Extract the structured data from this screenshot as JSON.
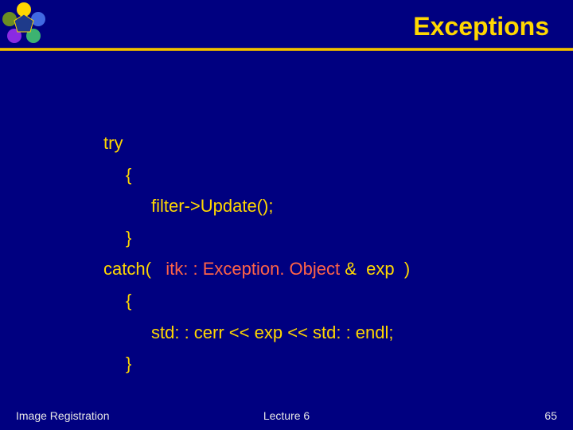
{
  "header": {
    "title": "Exceptions"
  },
  "code": {
    "line1": "try",
    "line2": "{",
    "line3": "filter->Update();",
    "line4": "}",
    "line5_a": "catch(   ",
    "line5_b": "itk: : Exception. Object ",
    "line5_c": "&  exp  )",
    "line6": "{",
    "line7": "std: : cerr << exp << std: : endl;",
    "line8": "}"
  },
  "footer": {
    "left": "Image Registration",
    "center": "Lecture 6",
    "right": "65"
  }
}
